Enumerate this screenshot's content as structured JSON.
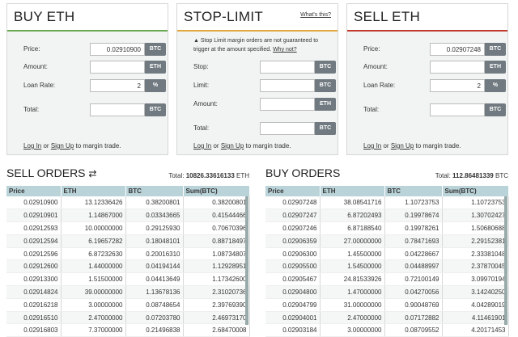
{
  "buy": {
    "title": "BUY ETH",
    "price_label": "Price:",
    "price_value": "0.02910900",
    "price_unit": "BTC",
    "amount_label": "Amount:",
    "amount_unit": "ETH",
    "loan_label": "Loan Rate:",
    "loan_value": "2",
    "loan_unit": "%",
    "total_label": "Total:",
    "total_unit": "BTC",
    "login": "Log In",
    "or": " or ",
    "signup": "Sign Up",
    "suffix": " to margin trade."
  },
  "stop": {
    "title": "STOP-LIMIT",
    "whats": "What's this?",
    "warning": "Stop Limit margin orders are not guaranteed to trigger at the amount specified.",
    "why": "Why not?",
    "stop_label": "Stop:",
    "stop_unit": "BTC",
    "limit_label": "Limit:",
    "limit_unit": "BTC",
    "amount_label": "Amount:",
    "amount_unit": "ETH",
    "total_label": "Total:",
    "total_unit": "BTC",
    "login": "Log In",
    "or": " or ",
    "signup": "Sign Up",
    "suffix": " to margin trade."
  },
  "sell": {
    "title": "SELL ETH",
    "price_label": "Price:",
    "price_value": "0.02907248",
    "price_unit": "BTC",
    "amount_label": "Amount:",
    "amount_unit": "ETH",
    "loan_label": "Loan Rate:",
    "loan_value": "2",
    "loan_unit": "%",
    "total_label": "Total:",
    "total_unit": "BTC",
    "login": "Log In",
    "or": " or ",
    "signup": "Sign Up",
    "suffix": " to margin trade."
  },
  "sell_orders": {
    "title": "SELL ORDERS",
    "icon": "swap-icon",
    "total_label": "Total: ",
    "total_value": "10826.33616133",
    "total_unit": " ETH",
    "columns": [
      "Price",
      "ETH",
      "BTC",
      "Sum(BTC)"
    ],
    "rows": [
      [
        "0.02910900",
        "13.12336426",
        "0.38200801",
        "0.38200801"
      ],
      [
        "0.02910901",
        "1.14867000",
        "0.03343665",
        "0.41544466"
      ],
      [
        "0.02912593",
        "10.00000000",
        "0.29125930",
        "0.70670396"
      ],
      [
        "0.02912594",
        "6.19657282",
        "0.18048101",
        "0.88718497"
      ],
      [
        "0.02912596",
        "6.87232630",
        "0.20016310",
        "1.08734807"
      ],
      [
        "0.02912600",
        "1.44000000",
        "0.04194144",
        "1.12928951"
      ],
      [
        "0.02913300",
        "1.51500000",
        "0.04413649",
        "1.17342600"
      ],
      [
        "0.02914824",
        "39.00000000",
        "1.13678136",
        "2.31020736"
      ],
      [
        "0.02916218",
        "3.00000000",
        "0.08748654",
        "2.39769390"
      ],
      [
        "0.02916510",
        "2.47000000",
        "0.07203780",
        "2.46973170"
      ],
      [
        "0.02916803",
        "7.37000000",
        "0.21496838",
        "2.68470008"
      ]
    ]
  },
  "buy_orders": {
    "title": "BUY ORDERS",
    "total_label": "Total: ",
    "total_value": "112.86481339",
    "total_unit": " BTC",
    "columns": [
      "Price",
      "ETH",
      "BTC",
      "Sum(BTC)"
    ],
    "rows": [
      [
        "0.02907248",
        "38.08541716",
        "1.10723753",
        "1.10723753"
      ],
      [
        "0.02907247",
        "6.87202493",
        "0.19978674",
        "1.30702427"
      ],
      [
        "0.02907246",
        "6.87188540",
        "0.19978261",
        "1.50680688"
      ],
      [
        "0.02906359",
        "27.00000000",
        "0.78471693",
        "2.29152381"
      ],
      [
        "0.02906300",
        "1.45500000",
        "0.04228667",
        "2.33381048"
      ],
      [
        "0.02905500",
        "1.54500000",
        "0.04488997",
        "2.37870045"
      ],
      [
        "0.02905467",
        "24.81533926",
        "0.72100149",
        "3.09970194"
      ],
      [
        "0.02904800",
        "1.47000000",
        "0.04270056",
        "3.14240250"
      ],
      [
        "0.02904799",
        "31.00000000",
        "0.90048769",
        "4.04289019"
      ],
      [
        "0.02904001",
        "2.47000000",
        "0.07172882",
        "4.11461901"
      ],
      [
        "0.02903184",
        "3.00000000",
        "0.08709552",
        "4.20171453"
      ]
    ]
  }
}
